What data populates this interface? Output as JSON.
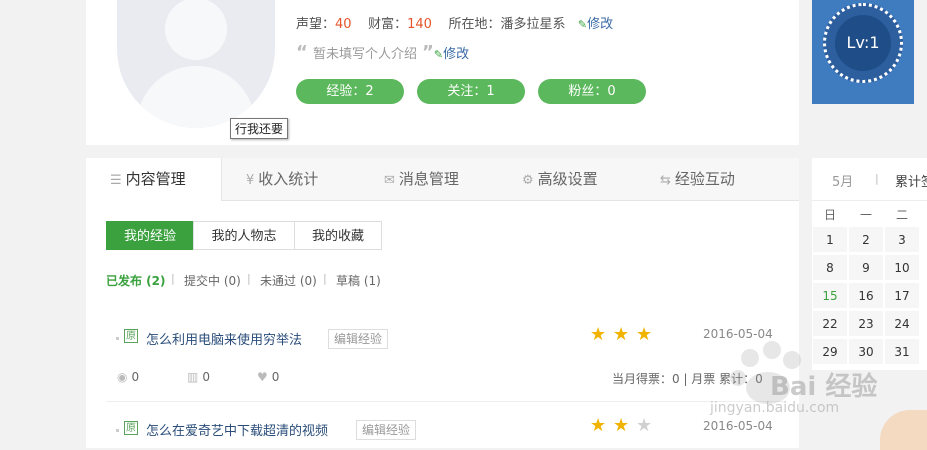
{
  "profile": {
    "reputation_label": "声望：",
    "reputation_value": "40",
    "wealth_label": "财富：",
    "wealth_value": "140",
    "location_label": "所在地：",
    "location_value": "潘多拉星系",
    "edit_label": "修改",
    "intro_placeholder": "暂未填写个人介绍",
    "intro_edit_label": "修改",
    "pills": [
      "经验：2",
      "关注：1",
      "粉丝：0"
    ],
    "tooltip": "行我还要",
    "level": "Lv:1"
  },
  "tabs": [
    {
      "label": "内容管理",
      "icon": "list-icon"
    },
    {
      "label": "收入统计",
      "icon": "yen-icon"
    },
    {
      "label": "消息管理",
      "icon": "mail-icon"
    },
    {
      "label": "高级设置",
      "icon": "gear-icon"
    },
    {
      "label": "经验互动",
      "icon": "swap-icon"
    }
  ],
  "subtabs": [
    "我的经验",
    "我的人物志",
    "我的收藏"
  ],
  "filters": [
    "已发布 (2)",
    "提交中 (0)",
    "未通过 (0)",
    "草稿 (1)"
  ],
  "experiences": [
    {
      "badge": "原",
      "title": "怎么利用电脑来使用穷举法",
      "edit": "编辑经验",
      "stars": 3,
      "date": "2016-05-04",
      "views": "0",
      "votes": "0",
      "likes": "0",
      "monthly": "当月得票：0 | 月票 累计：0"
    },
    {
      "badge": "原",
      "title": "怎么在爱奇艺中下载超清的视频",
      "edit": "编辑经验",
      "stars": 2,
      "date": "2016-05-04"
    }
  ],
  "calendar": {
    "month": "5月",
    "accumulate": "累计签",
    "weekdays": [
      "日",
      "一",
      "二"
    ],
    "weeks": [
      [
        "1",
        "2",
        "3"
      ],
      [
        "8",
        "9",
        "10"
      ],
      [
        "15",
        "16",
        "17"
      ],
      [
        "22",
        "23",
        "24"
      ],
      [
        "29",
        "30",
        "31"
      ]
    ],
    "highlight": "15"
  },
  "watermark": {
    "text": "Bai 经验",
    "url": "jingyan.baidu.com"
  },
  "colors": {
    "accent": "#3aa13e",
    "number": "#e4562a",
    "link": "#2a4d7a",
    "badge": "#3f7bbf",
    "star": "#f0b400"
  }
}
